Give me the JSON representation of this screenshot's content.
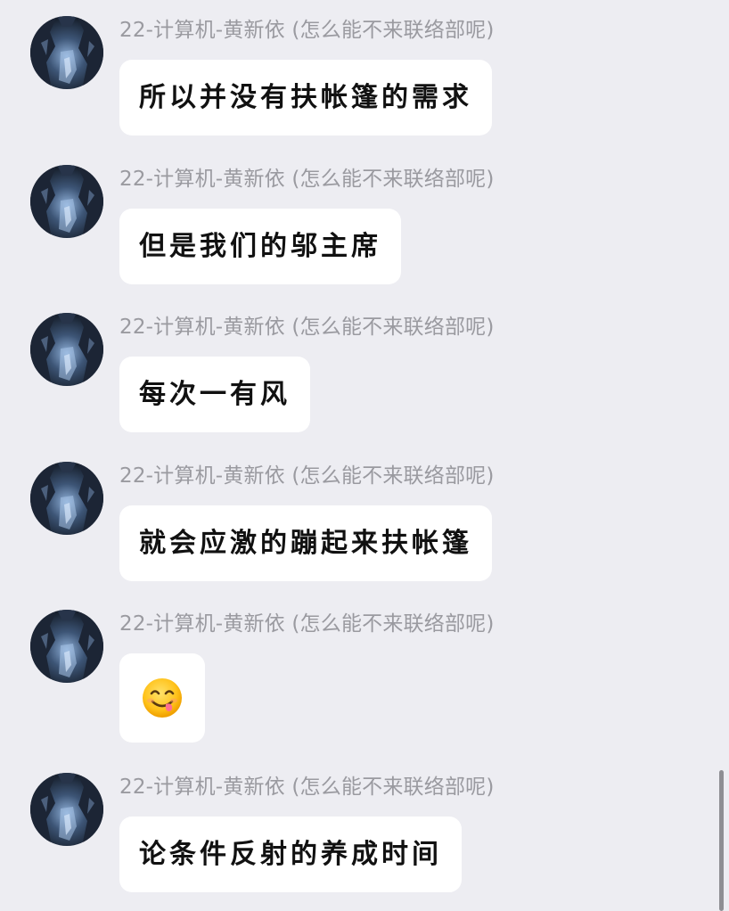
{
  "sender_name": "22-计算机-黄新依 (怎么能不来联络部呢)",
  "messages": [
    {
      "type": "text",
      "sender": "22-计算机-黄新依 (怎么能不来联络部呢)",
      "text": "所以并没有扶帐篷的需求"
    },
    {
      "type": "text",
      "sender": "22-计算机-黄新依 (怎么能不来联络部呢)",
      "text": "但是我们的邬主席"
    },
    {
      "type": "text",
      "sender": "22-计算机-黄新依 (怎么能不来联络部呢)",
      "text": "每次一有风"
    },
    {
      "type": "text",
      "sender": "22-计算机-黄新依 (怎么能不来联络部呢)",
      "text": "就会应激的蹦起来扶帐篷"
    },
    {
      "type": "emoji",
      "sender": "22-计算机-黄新依 (怎么能不来联络部呢)",
      "icon": "yum-face-emoji"
    },
    {
      "type": "text",
      "sender": "22-计算机-黄新依 (怎么能不来联络部呢)",
      "text": "论条件反射的养成时间"
    }
  ],
  "colors": {
    "background": "#ededf2",
    "bubble": "#ffffff",
    "sender_text": "#9a9aa0",
    "message_text": "#111111",
    "scrollbar": "#8e8e93"
  },
  "icons": {
    "avatar": "cave-photo-avatar",
    "emoji": "yum-face-emoji"
  }
}
